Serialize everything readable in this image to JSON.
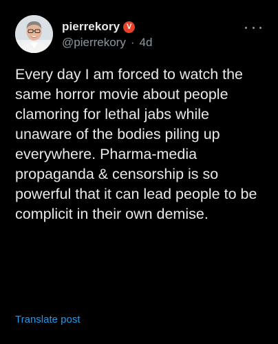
{
  "post": {
    "author": {
      "display_name": "pierrekory",
      "handle": "@pierrekory",
      "verified_badge_label": "V",
      "badge_color": "#e8412b"
    },
    "time_separator": "·",
    "timestamp": "4d",
    "more_icon": "more-horizontal-icon",
    "text": "Every day I am forced to watch the same horror movie about people clamoring for lethal jabs while unaware of the bodies piling up everywhere. Pharma-media propaganda & censorship is so powerful that it can lead people to be complicit in their own demise.",
    "translate_label": "Translate post",
    "link_color": "#1d9bf0"
  }
}
